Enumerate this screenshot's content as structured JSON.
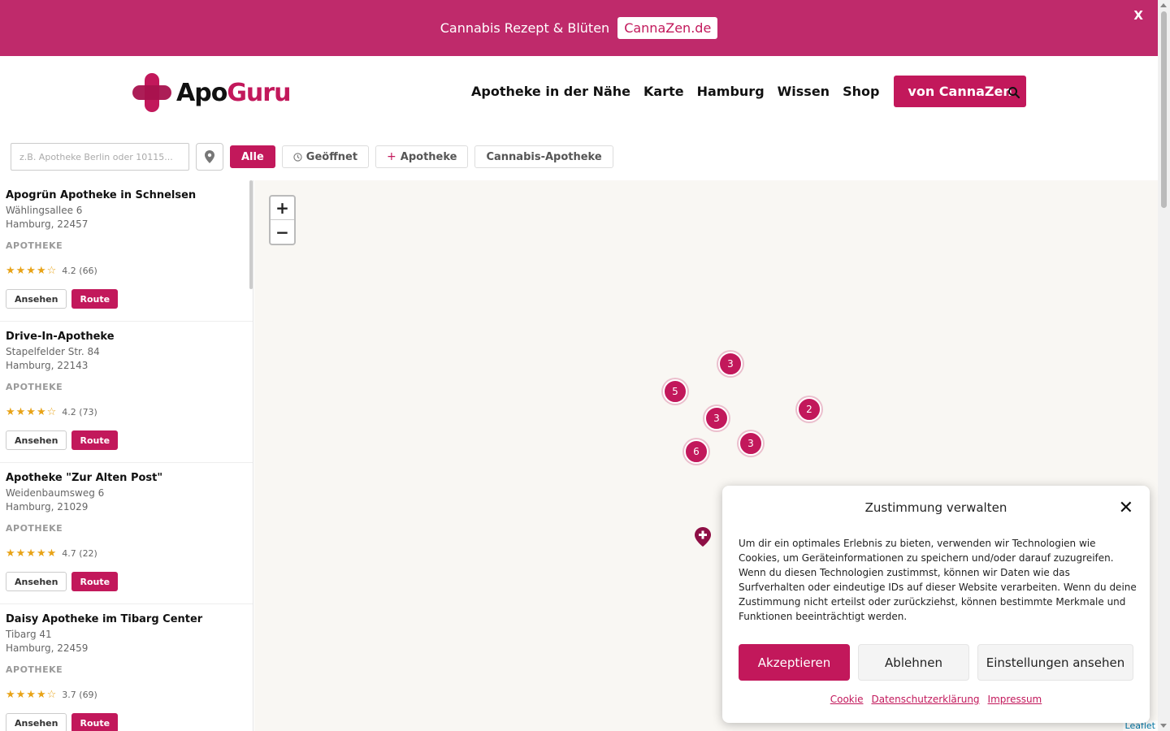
{
  "promo": {
    "text": "Cannabis Rezept & Blüten",
    "button": "CannaZen.de",
    "close": "X"
  },
  "header": {
    "logo_apo": "Apo",
    "logo_guru": "Guru",
    "nav": [
      "Apotheke in der Nähe",
      "Karte",
      "Hamburg",
      "Wissen",
      "Shop"
    ],
    "cta": "von CannaZen",
    "search_icon": "search-icon"
  },
  "filters": {
    "search_placeholder": "z.B. Apotheke Berlin oder 10115...",
    "location_icon": "map-pin-icon",
    "chips": [
      "Alle",
      "Geöffnet",
      "Apotheke",
      "Cannabis-Apotheke"
    ],
    "active_chip": "Alle"
  },
  "pharmacies": [
    {
      "name": "Apogrün Apotheke in Schnelsen",
      "street": "Wählingsallee 6",
      "city": "Hamburg, 22457",
      "type": "APOTHEKE",
      "stars": "★★★★☆",
      "rating": "4.2 (66)",
      "view": "Ansehen",
      "route": "Route"
    },
    {
      "name": "Drive-In-Apotheke",
      "street": "Stapelfelder Str. 84",
      "city": "Hamburg, 22143",
      "type": "APOTHEKE",
      "stars": "★★★★☆",
      "rating": "4.2 (73)",
      "view": "Ansehen",
      "route": "Route"
    },
    {
      "name": "Apotheke \"Zur Alten Post\"",
      "street": "Weidenbaumsweg 6",
      "city": "Hamburg, 21029",
      "type": "APOTHEKE",
      "stars": "★★★★★",
      "rating": "4.7 (22)",
      "view": "Ansehen",
      "route": "Route"
    },
    {
      "name": "Daisy Apotheke im Tibarg Center",
      "street": "Tibarg 41",
      "city": "Hamburg, 22459",
      "type": "APOTHEKE",
      "stars": "★★★★☆",
      "rating": "3.7 (69)",
      "view": "Ansehen",
      "route": "Route"
    }
  ],
  "map": {
    "zoom_in": "+",
    "zoom_out": "−",
    "clusters": [
      "3",
      "5",
      "3",
      "2",
      "6",
      "3"
    ],
    "attribution": "Leaflet"
  },
  "consent": {
    "title": "Zustimmung verwalten",
    "close": "✕",
    "text": "Um dir ein optimales Erlebnis zu bieten, verwenden wir Technologien wie Cookies, um Geräteinformationen zu speichern und/oder darauf zuzugreifen. Wenn du diesen Technologien zustimmst, können wir Daten wie das Surfverhalten oder eindeutige IDs auf dieser Website verarbeiten. Wenn du deine Zustimmung nicht erteilst oder zurückziehst, können bestimmte Merkmale und Funktionen beeinträchtigt werden.",
    "accept": "Akzeptieren",
    "deny": "Ablehnen",
    "settings": "Einstellungen ansehen",
    "links": [
      "Cookie",
      "Datenschutzerklärung",
      "Impressum"
    ]
  },
  "colors": {
    "brand": "#c2185b",
    "promo_bg": "#bf2a6b",
    "star": "#e8a317"
  }
}
